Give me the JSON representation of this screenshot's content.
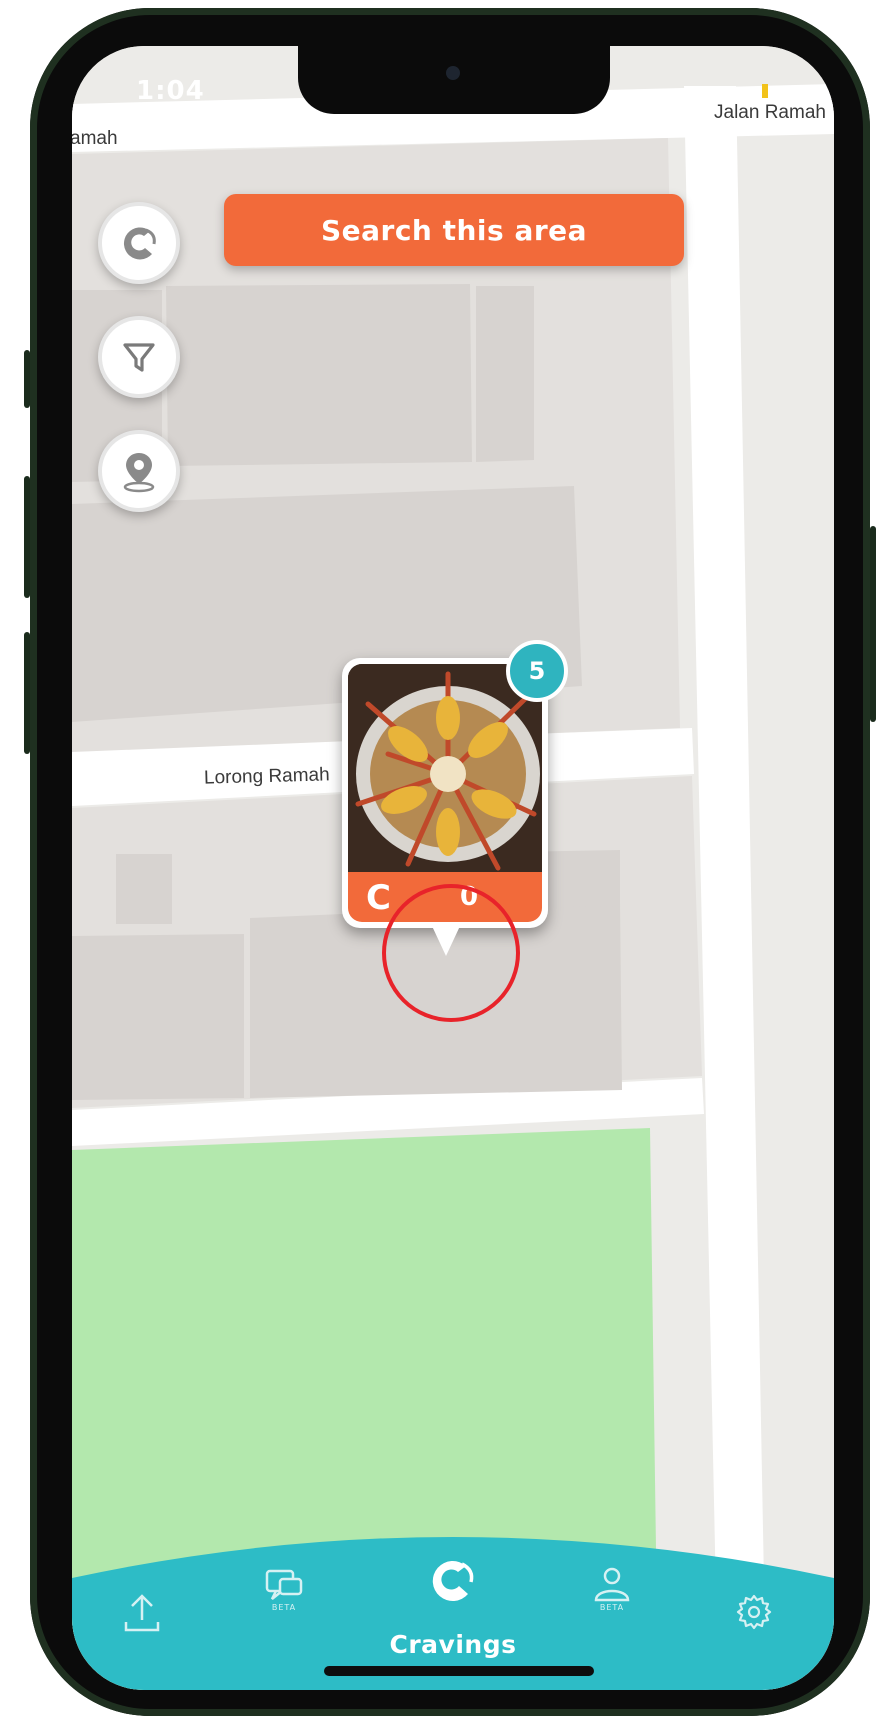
{
  "status_bar": {
    "time": "1:04"
  },
  "map": {
    "streets": [
      {
        "id": "top-left",
        "label": "amah"
      },
      {
        "id": "top-right",
        "label": "Jalan Ramah"
      },
      {
        "id": "middle",
        "label": "Lorong Ramah"
      }
    ]
  },
  "toolbar": {
    "search_label": "Search this area"
  },
  "side_buttons": [
    {
      "name": "app-logo-button",
      "icon": "crave-logo-icon"
    },
    {
      "name": "filter-button",
      "icon": "filter-icon"
    },
    {
      "name": "location-button",
      "icon": "location-pin-icon"
    }
  ],
  "marker": {
    "cluster_count": "5",
    "logo": "C",
    "count": "0"
  },
  "bottom_nav": {
    "items": [
      {
        "id": "upload",
        "icon": "upload-icon"
      },
      {
        "id": "chat",
        "icon": "chat-icon",
        "tag": "BETA"
      },
      {
        "id": "cravings",
        "icon": "crave-logo-icon",
        "label": "Cravings"
      },
      {
        "id": "profile",
        "icon": "user-icon",
        "tag": "BETA"
      },
      {
        "id": "settings",
        "icon": "gear-icon"
      }
    ]
  },
  "colors": {
    "accent": "#f26a3a",
    "teal": "#2fb4bf",
    "park": "#b3e8ad",
    "building": "#dcd8d5",
    "road": "#ffffff"
  }
}
